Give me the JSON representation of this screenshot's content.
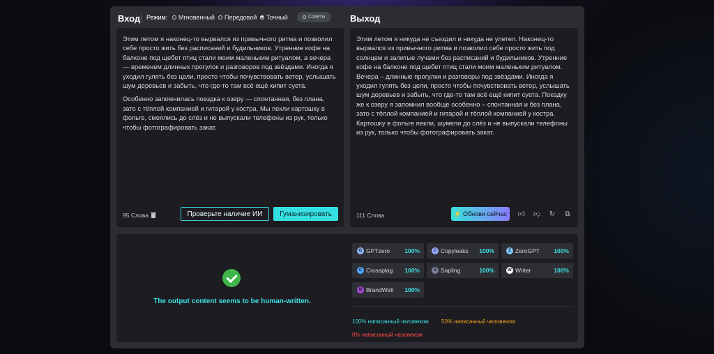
{
  "header": {
    "input_title": "Вход",
    "mode_label": "Режим:",
    "modes": [
      {
        "label": "Мгновенный",
        "selected": false
      },
      {
        "label": "Передовой",
        "selected": false
      },
      {
        "label": "Точный",
        "selected": true
      }
    ],
    "tips_label": "Советы",
    "output_title": "Выход"
  },
  "input": {
    "paragraphs": [
      "Этим летом я наконец-то вырвался из привычного ритма и позволил себе просто жить без расписаний и будильников. Утренние кофе на балконе под щебет птиц стали моим маленьким ритуалом, а вечера — временем длинных прогулок и разговоров под звёздами. Иногда я уходил гулять без цели, просто чтобы почувствовать ветер, услышать шум деревьев и забыть, что где-то там всё ещё кипит суета.",
      "Особенно запомнилась поездка к озеру — спонтанная, без плана, зато с тёплой компанией и гитарой у костра. Мы пекли картошку в фольге, смеялись до слёз и не выпускали телефоны из рук, только чтобы фотографировать закат."
    ],
    "word_count": "95 Слова",
    "check_button": "Проверьте наличие ИИ",
    "humanize_button": "Гуманизировать"
  },
  "output": {
    "paragraphs": [
      "Этим летом я никуда не съездил и никуда не улетел. Наконец-то вырвался из привычного ритма и позволил себе просто жить под солнцем и залитые лучами без расписаний и будильников. Утренние кофе на балконе под щебет птиц стали моим маленьким ритуалом. Вечера – длинные прогулки и разговоры под звёздами. Иногда я уходил гулять без цели, просто чтобы почувствовать ветер, услышать шум деревьев и забыть, что где-то там всё ещё кипит суета. Поездку же к озеру я запомнил вообще особенно – спонтанная и без плана, зато с тёплой компанией и гитарой и тёплой компанией у костра. Картошку в фольге пекли, шумели до слёз и не выпускали телефоны из рук, только чтобы фотографировать закат."
    ],
    "word_count": "111 Слова",
    "update_button": "Обнови сейчас"
  },
  "result": {
    "message": "The output content seems to be human-written.",
    "detectors": [
      {
        "name": "GPTzero",
        "value": "100%",
        "icon": "gptzero-icon",
        "color": "#8fb4ff"
      },
      {
        "name": "Copyleaks",
        "value": "100%",
        "icon": "copyleaks-icon",
        "color": "#9aa7ff"
      },
      {
        "name": "ZeroGPT",
        "value": "100%",
        "icon": "zerogpt-icon",
        "color": "#7fc8ff"
      },
      {
        "name": "Crossplag",
        "value": "100%",
        "icon": "crossplag-icon",
        "color": "#4fa8ff"
      },
      {
        "name": "Sapling",
        "value": "100%",
        "icon": "sapling-icon",
        "color": "#7a7f9a"
      },
      {
        "name": "Writer",
        "value": "100%",
        "icon": "writer-icon",
        "color": "#ffffff"
      },
      {
        "name": "BrandWell",
        "value": "100%",
        "icon": "brandwell-icon",
        "color": "#a64ad8"
      }
    ],
    "legend": [
      {
        "label": "100% написанный человеком",
        "color": "#3de0e3"
      },
      {
        "label": "50% написанный человеком",
        "color": "#f0a020"
      },
      {
        "label": "0% написанный человеком",
        "color": "#ff4a4a"
      }
    ]
  },
  "colors": {
    "accent": "#34dfe2",
    "success": "#40b54b"
  }
}
